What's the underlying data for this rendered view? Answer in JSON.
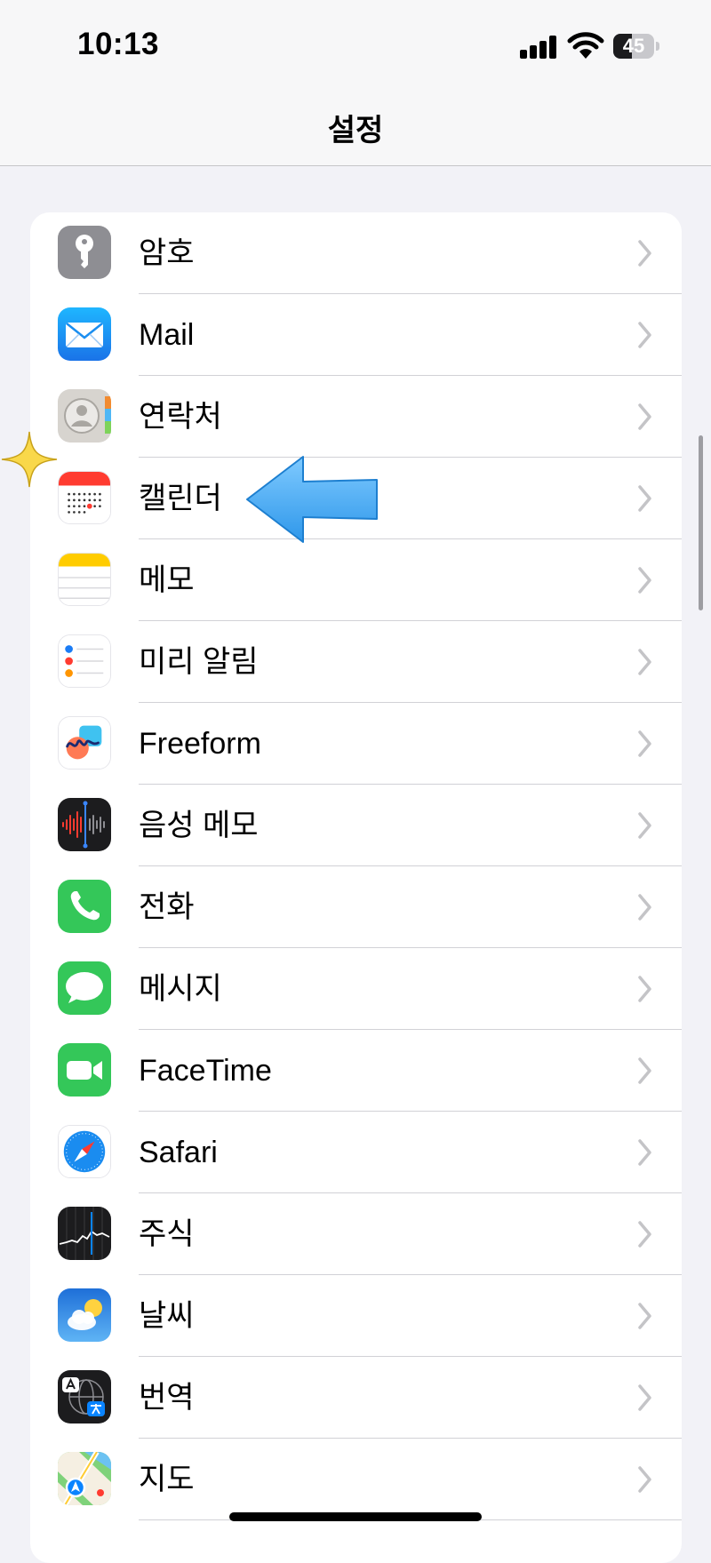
{
  "status_bar": {
    "time": "10:13",
    "battery_level": "45",
    "battery_percent": 45
  },
  "nav": {
    "title": "설정"
  },
  "colors": {
    "arrow": "#3aa9f4",
    "sparkle": "#f9d84a",
    "chevron": "#c4c4c7",
    "separator": "#d1d1d6"
  },
  "settings": [
    {
      "label": "암호",
      "icon": "key-icon"
    },
    {
      "label": "Mail",
      "icon": "mail-icon"
    },
    {
      "label": "연락처",
      "icon": "contacts-icon"
    },
    {
      "label": "캘린더",
      "icon": "calendar-icon"
    },
    {
      "label": "메모",
      "icon": "notes-icon"
    },
    {
      "label": "미리 알림",
      "icon": "reminders-icon"
    },
    {
      "label": "Freeform",
      "icon": "freeform-icon"
    },
    {
      "label": "음성 메모",
      "icon": "voice-memos-icon"
    },
    {
      "label": "전화",
      "icon": "phone-icon"
    },
    {
      "label": "메시지",
      "icon": "messages-icon"
    },
    {
      "label": "FaceTime",
      "icon": "facetime-icon"
    },
    {
      "label": "Safari",
      "icon": "safari-icon"
    },
    {
      "label": "주식",
      "icon": "stocks-icon"
    },
    {
      "label": "날씨",
      "icon": "weather-icon"
    },
    {
      "label": "번역",
      "icon": "translate-icon"
    },
    {
      "label": "지도",
      "icon": "maps-icon"
    }
  ],
  "annotations": {
    "highlighted_item": "캘린더",
    "arrow_icon": "blue-arrow-icon",
    "sparkle_icon": "sparkle-icon"
  }
}
